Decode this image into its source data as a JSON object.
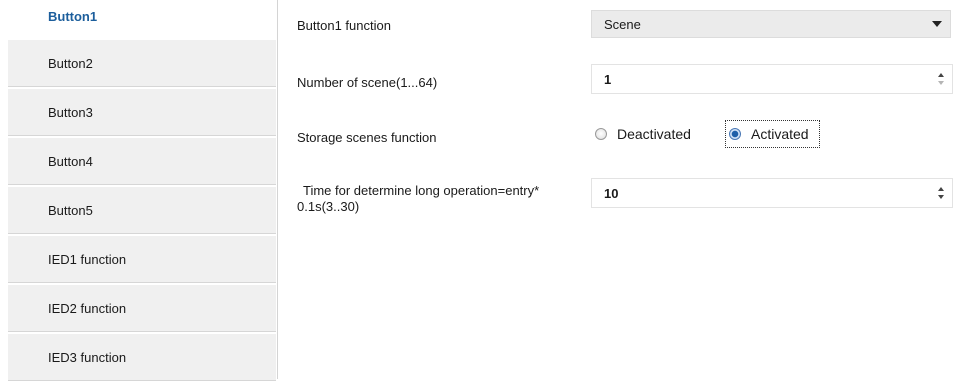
{
  "sidebar": {
    "items": [
      {
        "label": "Button1",
        "active": true
      },
      {
        "label": "Button2",
        "active": false
      },
      {
        "label": "Button3",
        "active": false
      },
      {
        "label": "Button4",
        "active": false
      },
      {
        "label": "Button5",
        "active": false
      },
      {
        "label": "IED1 function",
        "active": false
      },
      {
        "label": "IED2 function",
        "active": false
      },
      {
        "label": "IED3 function",
        "active": false
      }
    ]
  },
  "params": {
    "button_function": {
      "label": "Button1 function",
      "value": "Scene"
    },
    "scene_number": {
      "label": "Number of scene(1...64)",
      "value": "1"
    },
    "storage": {
      "label": "Storage scenes function",
      "options": [
        "Deactivated",
        "Activated"
      ],
      "selected": "Activated"
    },
    "long_operation": {
      "label_line1": "Time for determine long operation=entry*",
      "label_line2": "0.1s(3..30)",
      "value": "10"
    }
  },
  "colors": {
    "active_item": "#1c5e9c",
    "sidebar_bg": "#f0f0f0",
    "select_bg": "#ebebeb"
  }
}
